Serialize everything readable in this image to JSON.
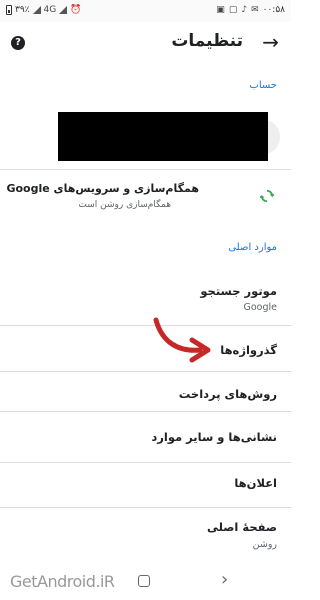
{
  "statusbar": {
    "time": "۰۰:۵۸",
    "battery": "۳۹٪",
    "network": "4G"
  },
  "header": {
    "title": "تنظیمات"
  },
  "sections": {
    "account": "حساب",
    "basics": "موارد اصلی"
  },
  "sync": {
    "title": "همگام‌سازی و سرویس‌های Google",
    "subtitle": "همگام‌سازی روشن است"
  },
  "items": [
    {
      "title": "موتور جستجو",
      "subtitle": "Google"
    },
    {
      "title": "گذرواژه‌ها",
      "subtitle": ""
    },
    {
      "title": "روش‌های پرداخت",
      "subtitle": ""
    },
    {
      "title": "نشانی‌ها و سایر موارد",
      "subtitle": ""
    },
    {
      "title": "اعلان‌ها",
      "subtitle": ""
    },
    {
      "title": "صفحهٔ اصلی",
      "subtitle": "روشن"
    }
  ],
  "watermark": "GetAndroid.iR",
  "colors": {
    "accent": "#1a73e8",
    "sync_icon": "#34a853",
    "annotation_arrow": "#c62828"
  },
  "icons": {
    "back": "arrow-right-icon",
    "help": "help-icon",
    "sync": "sync-icon"
  }
}
